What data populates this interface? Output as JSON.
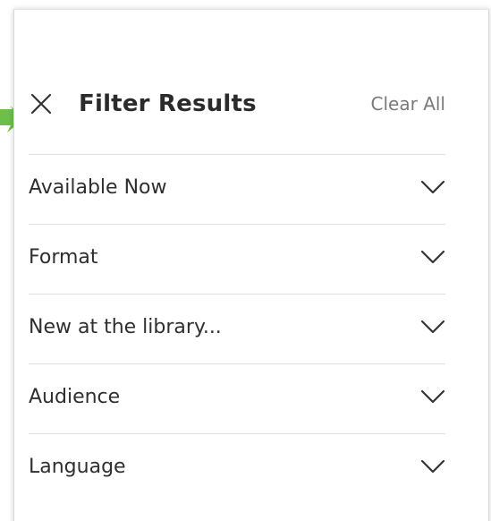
{
  "header": {
    "title": "Filter Results",
    "clear_all_label": "Clear All"
  },
  "filters": [
    {
      "label": "Available Now"
    },
    {
      "label": "Format"
    },
    {
      "label": "New at the library..."
    },
    {
      "label": "Audience"
    },
    {
      "label": "Language"
    }
  ],
  "colors": {
    "accent_arrow": "#6cc04a",
    "title_text": "#2b2b2b",
    "muted_text": "#7a7a7a",
    "divider": "#e0e0e0"
  },
  "icons": {
    "close": "close-icon",
    "chevron": "chevron-down-icon",
    "pointer": "arrow-right-icon"
  }
}
